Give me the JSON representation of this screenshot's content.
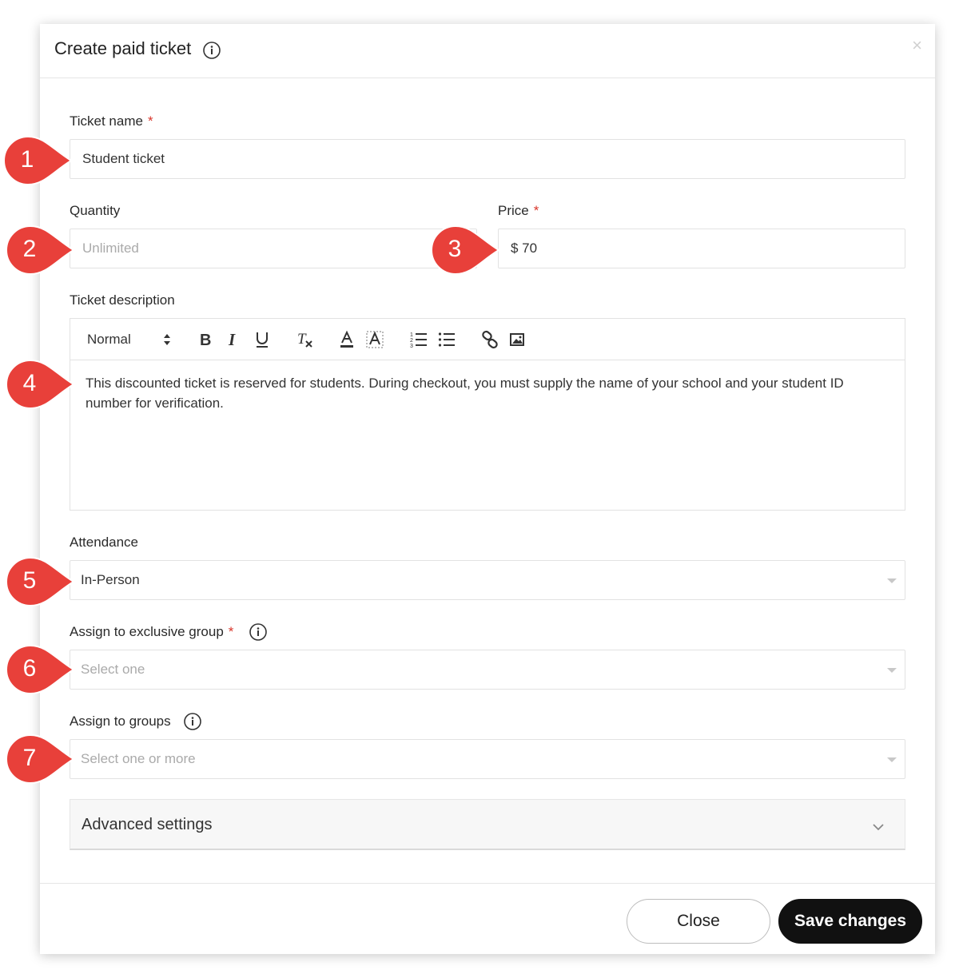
{
  "dialog": {
    "title": "Create paid ticket",
    "close_glyph": "×"
  },
  "form": {
    "ticket_name": {
      "label": "Ticket name",
      "required_mark": "*",
      "value": "Student ticket"
    },
    "quantity": {
      "label": "Quantity",
      "placeholder": "Unlimited"
    },
    "price": {
      "label": "Price",
      "required_mark": "*",
      "value": "$ 70"
    },
    "description": {
      "label": "Ticket description",
      "format_value": "Normal",
      "toolbar_icons": [
        "bold-icon",
        "italic-icon",
        "underline-icon",
        "clear-format-icon",
        "text-color-icon",
        "highlight-icon",
        "ordered-list-icon",
        "bullet-list-icon",
        "link-icon",
        "image-icon"
      ],
      "text": "This discounted ticket is reserved for students. During checkout, you must supply the name of your school and your student ID number for verification."
    },
    "attendance": {
      "label": "Attendance",
      "value": "In-Person"
    },
    "exclusive_group": {
      "label": "Assign to exclusive group",
      "required_mark": "*",
      "placeholder": "Select one"
    },
    "groups": {
      "label": "Assign to groups",
      "placeholder": "Select one or more"
    },
    "advanced": {
      "label": "Advanced settings"
    }
  },
  "footer": {
    "close_label": "Close",
    "save_label": "Save changes"
  },
  "callouts": [
    "1",
    "2",
    "3",
    "4",
    "5",
    "6",
    "7"
  ],
  "colors": {
    "callout_red": "#e8403a",
    "required_red": "#d9362b",
    "save_button": "#111111"
  }
}
